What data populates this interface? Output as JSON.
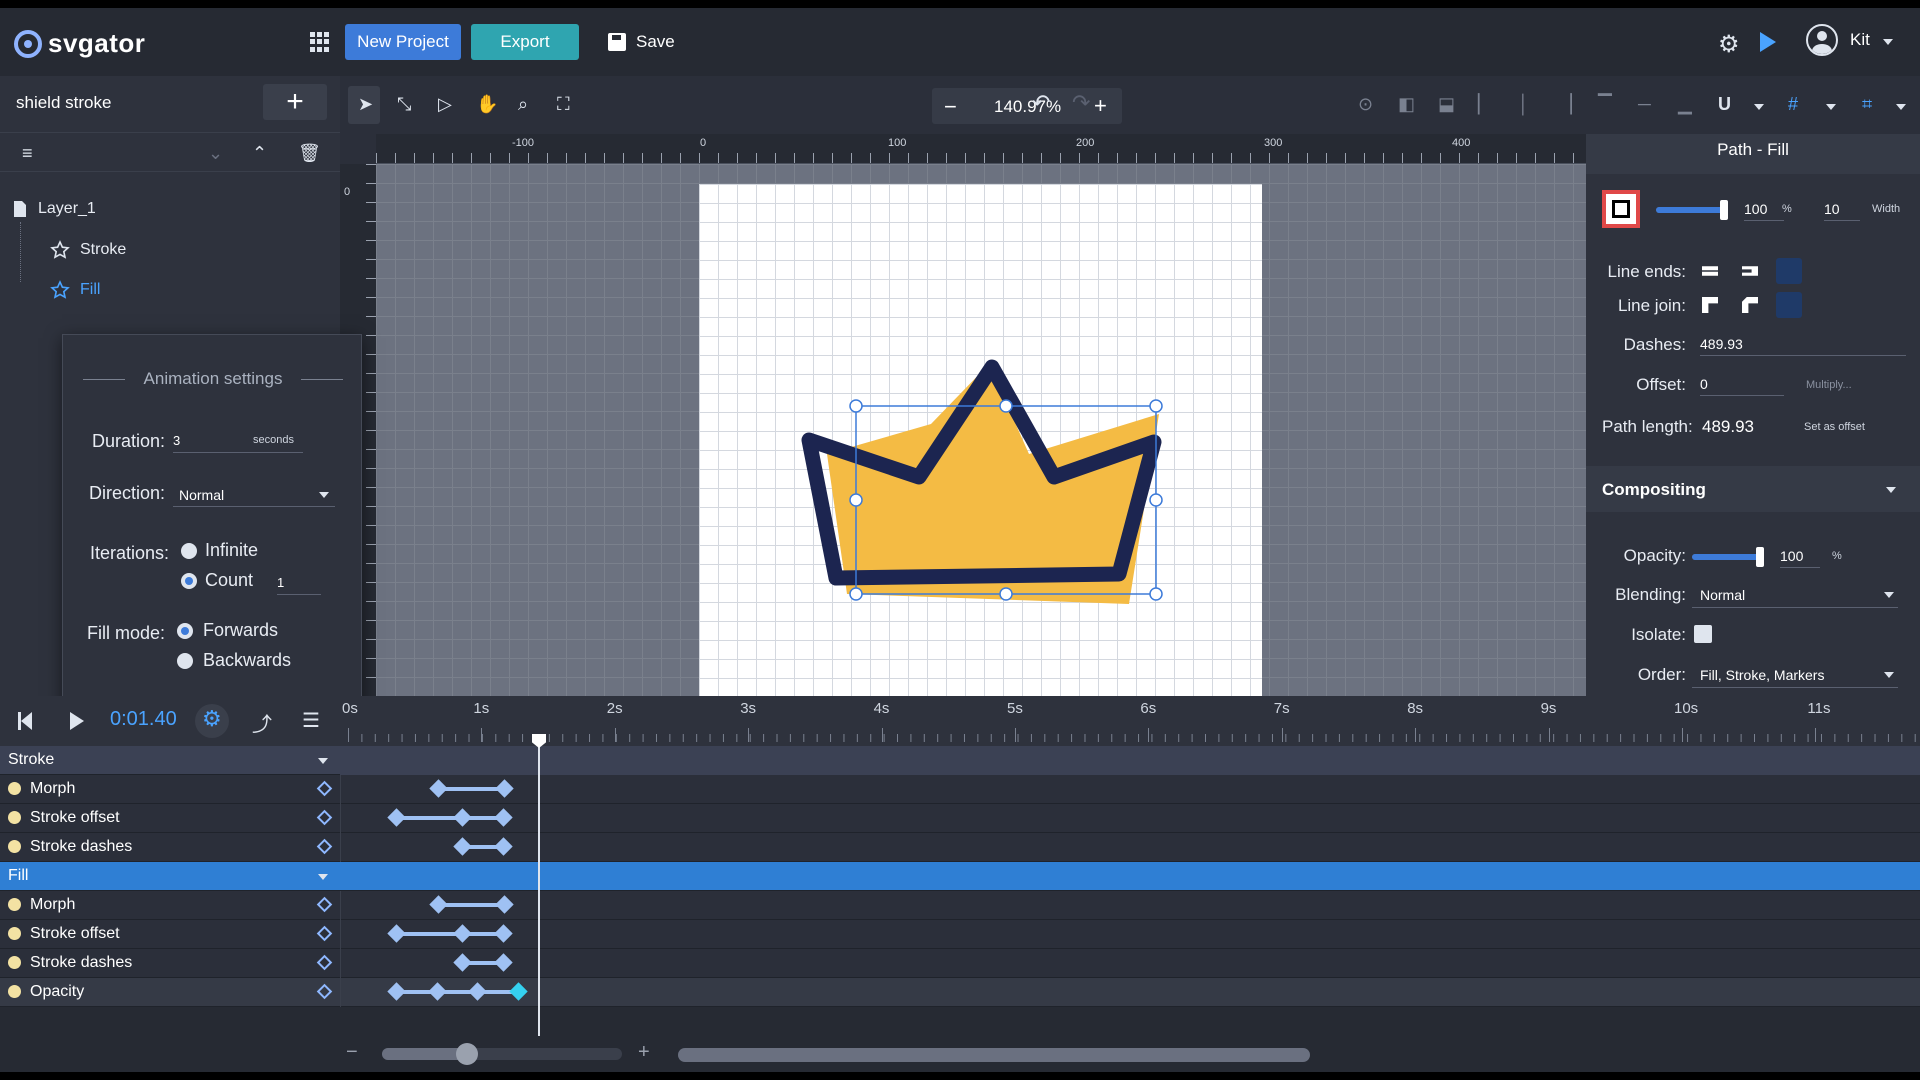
{
  "app": {
    "logo": "svgator",
    "user": "Kit"
  },
  "header": {
    "new_project": "New Project",
    "export": "Export",
    "save": "Save"
  },
  "project": {
    "name": "shield stroke"
  },
  "layers": [
    {
      "label": "Layer_1"
    },
    {
      "label": "Stroke"
    },
    {
      "label": "Fill"
    }
  ],
  "animation_settings": {
    "title": "Animation settings",
    "duration_label": "Duration:",
    "duration_value": "3",
    "duration_unit": "seconds",
    "direction_label": "Direction:",
    "direction_value": "Normal",
    "iterations_label": "Iterations:",
    "iter_infinite": "Infinite",
    "iter_count": "Count",
    "iter_count_value": "1",
    "fill_mode_label": "Fill mode:",
    "fill_forwards": "Forwards",
    "fill_backwards": "Backwards"
  },
  "toolbar": {
    "zoom": "140.97%"
  },
  "ruler": {
    "top_labels": [
      "-100",
      "0",
      "100",
      "200",
      "300",
      "400"
    ],
    "left_labels": [
      "0"
    ]
  },
  "panel": {
    "title": "Path - Fill",
    "stroke_opacity": "100",
    "percent": "%",
    "stroke_width": "10",
    "width_label": "Width",
    "line_ends_label": "Line ends:",
    "line_join_label": "Line join:",
    "dashes_label": "Dashes:",
    "dashes_value": "489.93",
    "offset_label": "Offset:",
    "offset_value": "0",
    "multiply_label": "Multiply...",
    "path_length_label": "Path length:",
    "path_length_value": "489.93",
    "set_as_offset": "Set as offset",
    "compositing": "Compositing",
    "opacity_label": "Opacity:",
    "opacity_value": "100",
    "blending_label": "Blending:",
    "blending_value": "Normal",
    "isolate_label": "Isolate:",
    "order_label": "Order:",
    "order_value": "Fill, Stroke, Markers"
  },
  "timeline": {
    "time": "0:01.40",
    "seconds": [
      "0s",
      "1s",
      "2s",
      "3s",
      "4s",
      "5s",
      "6s",
      "7s",
      "8s",
      "9s",
      "10s",
      "11s"
    ],
    "groups": [
      {
        "label": "Stroke",
        "selected": false,
        "rows": [
          "Morph",
          "Stroke offset",
          "Stroke dashes"
        ]
      },
      {
        "label": "Fill",
        "selected": true,
        "rows": [
          "Morph",
          "Stroke offset",
          "Stroke dashes",
          "Opacity"
        ]
      }
    ]
  },
  "colors": {
    "accent": "#3d7bd9",
    "export": "#2fa5b0",
    "crown_fill": "#f4bb44",
    "crown_stroke": "#1c2550",
    "playhead_time": "#4aa3ff"
  }
}
